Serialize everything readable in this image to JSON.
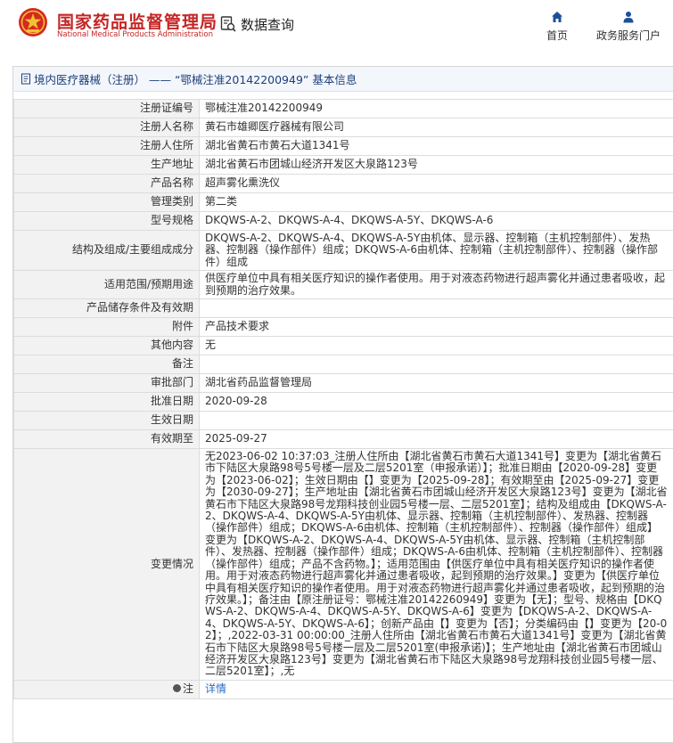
{
  "header": {
    "brand_cn": "国家药品监督管理局",
    "brand_en": "National Medical Products Administration",
    "query_label": "数据查询",
    "nav": {
      "home": "首页",
      "service": "政务服务门户"
    }
  },
  "panel": {
    "title": "境内医疗器械（注册） —— “鄂械注准20142200949” 基本信息"
  },
  "rows": [
    {
      "label": "注册证编号",
      "value": "鄂械注准20142200949"
    },
    {
      "label": "注册人名称",
      "value": "黄石市雄卿医疗器械有限公司"
    },
    {
      "label": "注册人住所",
      "value": "湖北省黄石市黄石大道1341号"
    },
    {
      "label": "生产地址",
      "value": "湖北省黄石市团城山经济开发区大泉路123号"
    },
    {
      "label": "产品名称",
      "value": "超声雾化熏洗仪"
    },
    {
      "label": "管理类别",
      "value": "第二类"
    },
    {
      "label": "型号规格",
      "value": "DKQWS-A-2、DKQWS-A-4、DKQWS-A-5Y、DKQWS-A-6"
    },
    {
      "label": "结构及组成/主要组成成分",
      "value": "DKQWS-A-2、DKQWS-A-4、DKQWS-A-5Y由机体、显示器、控制箱（主机控制部件）、发热器、控制器（操作部件）组成；DKQWS-A-6由机体、控制箱（主机控制部件）、控制器（操作部件）组成"
    },
    {
      "label": "适用范围/预期用途",
      "value": "供医疗单位中具有相关医疗知识的操作者使用。用于对液态药物进行超声雾化并通过患者吸收，起到预期的治疗效果。"
    },
    {
      "label": "产品储存条件及有效期",
      "value": ""
    },
    {
      "label": "附件",
      "value": "产品技术要求"
    },
    {
      "label": "其他内容",
      "value": "无"
    },
    {
      "label": "备注",
      "value": ""
    },
    {
      "label": "审批部门",
      "value": "湖北省药品监督管理局"
    },
    {
      "label": "批准日期",
      "value": "2020-09-28"
    },
    {
      "label": "生效日期",
      "value": ""
    },
    {
      "label": "有效期至",
      "value": "2025-09-27"
    },
    {
      "label": "变更情况",
      "value": "无2023-06-02 10:37:03_注册人住所由【湖北省黄石市黄石大道1341号】变更为【湖北省黄石市下陆区大泉路98号5号楼一层及二层5201室（申报承诺）】；批准日期由【2020-09-28】变更为【2023-06-02】；生效日期由【】变更为【2025-09-28】；有效期至由【2025-09-27】变更为【2030-09-27】；生产地址由【湖北省黄石市团城山经济开发区大泉路123号】变更为【湖北省黄石市下陆区大泉路98号龙翔科技创业园5号楼一层、二层5201室】；结构及组成由【DKQWS-A-2、DKQWS-A-4、DKQWS-A-5Y由机体、显示器、控制箱（主机控制部件）、发热器、控制器（操作部件）组成；DKQWS-A-6由机体、控制箱（主机控制部件）、控制器（操作部件）组成】变更为【DKQWS-A-2、DKQWS-A-4、DKQWS-A-5Y由机体、显示器、控制箱（主机控制部件）、发热器、控制器（操作部件）组成；DKQWS-A-6由机体、控制箱（主机控制部件）、控制器（操作部件）组成；产品不含药物。】；适用范围由【供医疗单位中具有相关医疗知识的操作者使用。用于对液态药物进行超声雾化并通过患者吸收，起到预期的治疗效果。】变更为【供医疗单位中具有相关医疗知识的操作者使用。用于对液态药物进行超声雾化并通过患者吸收，起到预期的治疗效果。】；备注由【原注册证号：鄂械注准20142260949】变更为【无】；型号、规格由【DKQWS-A-2、DKQWS-A-4、DKQWS-A-5Y、DKQWS-A-6】变更为【DKQWS-A-2、DKQWS-A-4、DKQWS-A-5Y、DKQWS-A-6】；创新产品由【】变更为【否】；分类编码由【】变更为【20-02】；,2022-03-31 00:00:00_注册人住所由【湖北省黄石市黄石大道1341号】变更为【湖北省黄石市下陆区大泉路98号5号楼一层及二层5201室(申报承诺)】；生产地址由【湖北省黄石市团城山经济开发区大泉路123号】变更为【湖北省黄石市下陆区大泉路98号龙翔科技创业园5号楼一层、二层5201室】；,无"
    },
    {
      "label": "注",
      "value": "详情"
    }
  ],
  "colors": {
    "brand_red": "#c42525",
    "title_blue": "#1c3f7a",
    "link_blue": "#2a6bc9"
  },
  "icons": {
    "logo": "emblem-logo",
    "query": "search-document-icon",
    "home": "home-icon",
    "service": "user-icon",
    "title": "document-icon",
    "note": "note-icon"
  }
}
